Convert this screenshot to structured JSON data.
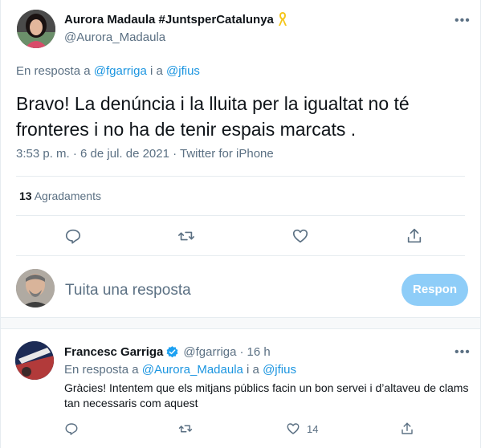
{
  "tweet": {
    "author_name": "Aurora Madaula #JuntsperCatalunya",
    "author_handle": "@Aurora_Madaula",
    "reply_prefix": "En resposta a",
    "reply_to_1": "@fgarriga",
    "reply_connector": "i a",
    "reply_to_2": "@jfius",
    "text": "Bravo! La denúncia i la lluita per la igualtat no té fronteres i no ha de tenir espais marcats .",
    "timestamp": "3:53 p. m. · 6 de jul. de 2021 · Twitter for iPhone",
    "likes_count": "13",
    "likes_label": "Agradaments",
    "more_icon": "more-icon",
    "ribbon_color": "#f5c518"
  },
  "compose": {
    "placeholder": "Tuita una resposta",
    "button_label": "Respon"
  },
  "reply": {
    "author_name": "Francesc Garriga",
    "author_handle": "@fgarriga",
    "separator": "·",
    "time": "16 h",
    "reply_prefix": "En resposta a",
    "reply_to_1": "@Aurora_Madaula",
    "reply_connector": "i a",
    "reply_to_2": "@jfius",
    "text": "Gràcies! Intentem que els mitjans públics facin un bon servei i d’altaveu de clams tan necessaris com aquest",
    "likes_count": "14"
  },
  "colors": {
    "link": "#1b95e0",
    "muted": "#5b7083",
    "button": "#8ecdf8",
    "verified": "#1da1f2"
  }
}
